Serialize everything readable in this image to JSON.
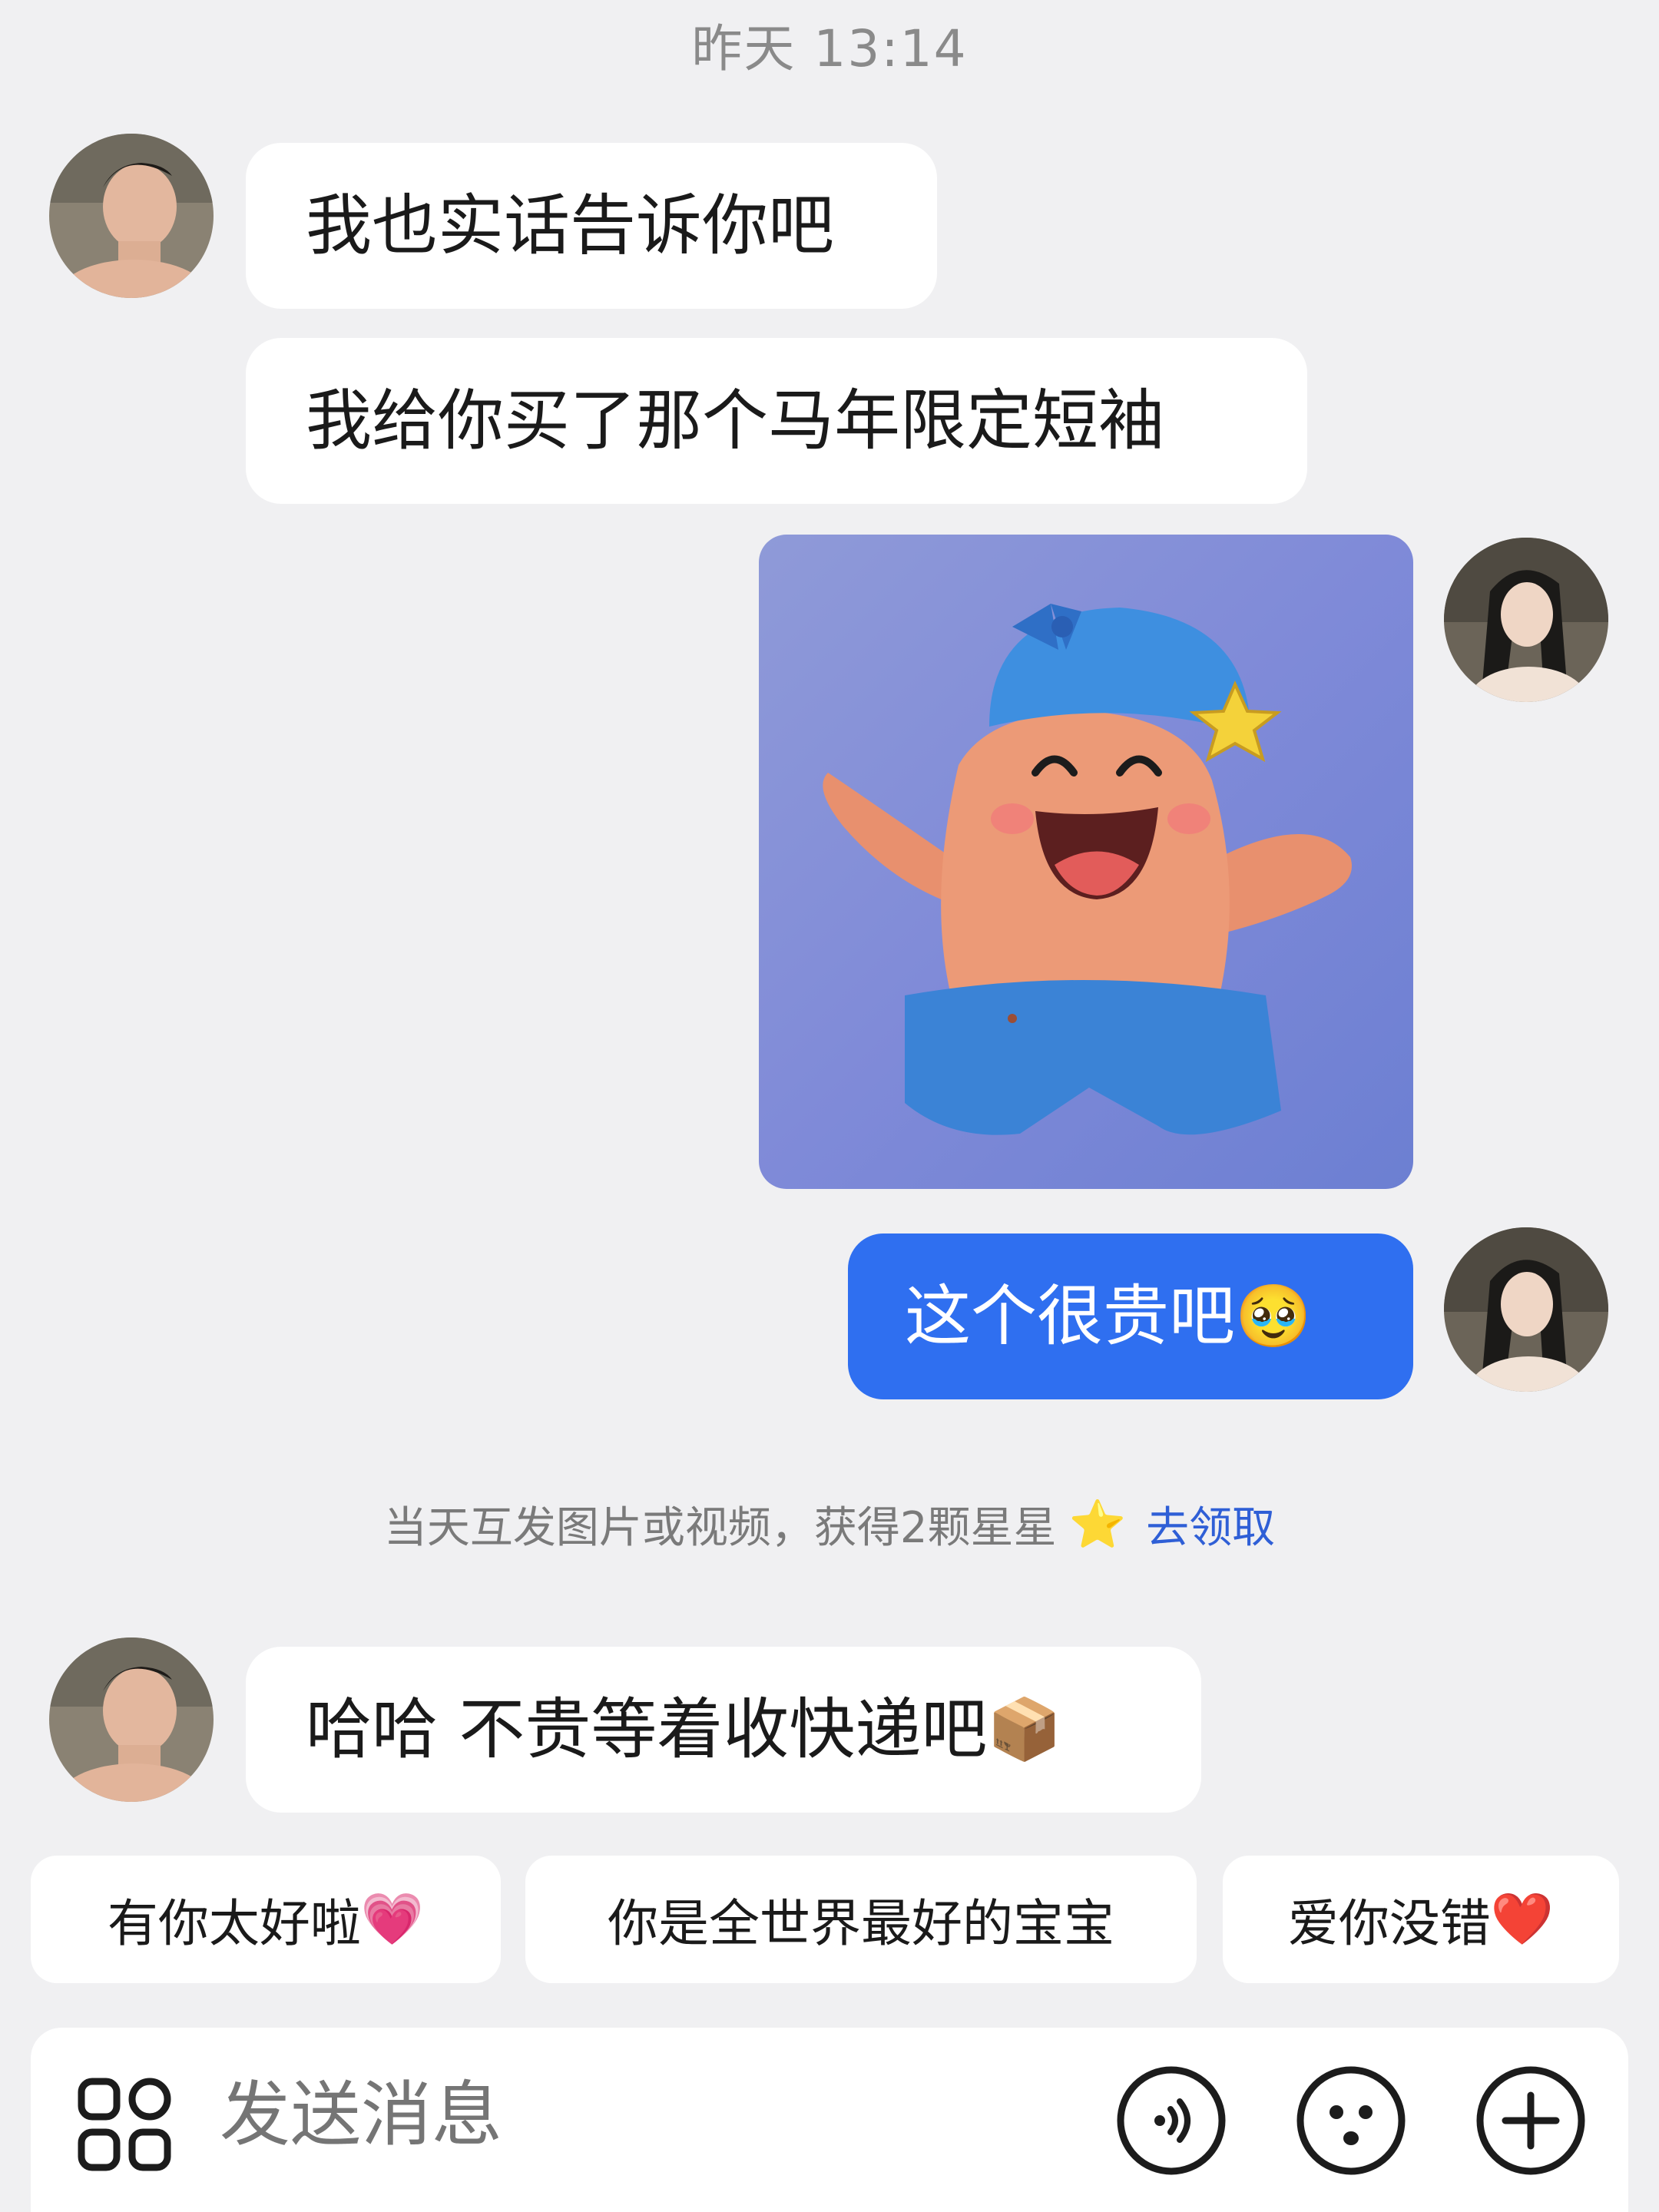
{
  "timestamp": "昨天 13:14",
  "messages": [
    {
      "text": "我也实话告诉你吧"
    },
    {
      "text": "我给你买了那个马年限定短袖"
    },
    {
      "text": "这个很贵吧",
      "emoji": "🥹"
    },
    {
      "text": "哈哈 不贵等着收快递吧",
      "emoji": "📦"
    }
  ],
  "notice": {
    "text": "当天互发图片或视频，获得2颗星星",
    "star": "⭐",
    "link": "去领取"
  },
  "quick_replies": [
    {
      "text": "有你太好啦",
      "emoji": "💗"
    },
    {
      "text": "你是全世界最好的宝宝",
      "emoji": ""
    },
    {
      "text": "爱你没错",
      "emoji": "❤️"
    }
  ],
  "input": {
    "placeholder": "发送消息"
  },
  "icons": {
    "apps": "apps-grid-icon",
    "voice": "voice-icon",
    "emoji": "emoji-face-icon",
    "plus": "plus-icon"
  },
  "colors": {
    "background": "#f0f0f2",
    "my_bubble": "#2f6ff0",
    "their_bubble": "#ffffff",
    "link": "#2f5fd6"
  }
}
